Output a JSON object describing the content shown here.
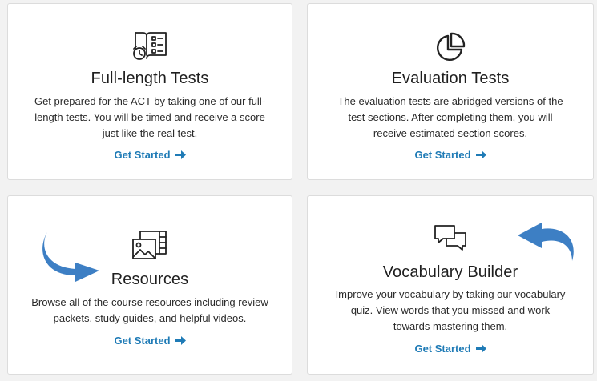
{
  "cards": [
    {
      "title": "Full-length Tests",
      "desc_lines": [
        "Get prepared for the ACT by taking one of our full-",
        "length tests. You will be timed and receive a score",
        "just like the real test."
      ],
      "cta": "Get Started",
      "icon": "book-clock-icon"
    },
    {
      "title": "Evaluation Tests",
      "desc_lines": [
        "The evaluation tests are abridged versions of the",
        "test sections. After completing them, you will",
        "receive estimated section scores."
      ],
      "cta": "Get Started",
      "icon": "pie-chart-icon"
    },
    {
      "title": "Resources",
      "desc_lines": [
        "Browse all of the course resources including review",
        "packets, study guides, and helpful videos."
      ],
      "cta": "Get Started",
      "icon": "media-icon"
    },
    {
      "title": "Vocabulary Builder",
      "desc_lines": [
        "Improve your vocabulary by taking our vocabulary",
        "quiz. View words that you missed and work",
        "towards mastering them."
      ],
      "cta": "Get Started",
      "icon": "chat-bubbles-icon"
    }
  ],
  "colors": {
    "link": "#1f7bb6",
    "annotation_arrow": "#3d7fc4",
    "card_border": "#dcdcdc",
    "background": "#f2f2f2"
  }
}
